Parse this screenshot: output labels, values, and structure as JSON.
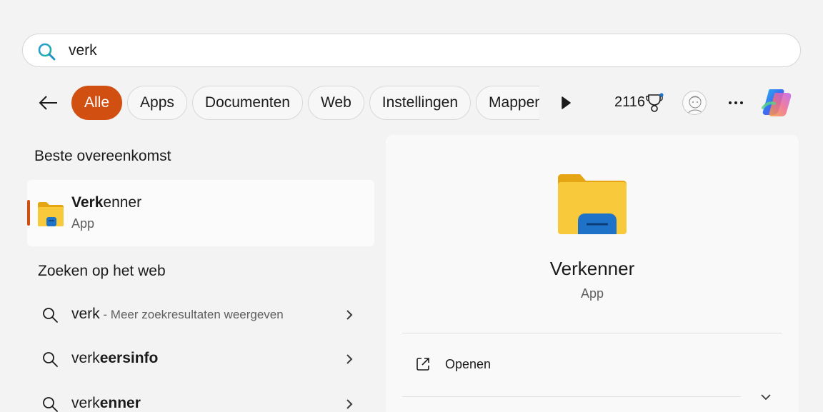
{
  "search": {
    "value": "verk",
    "placeholder": ""
  },
  "filters": {
    "chips": [
      {
        "label": "Alle",
        "active": true
      },
      {
        "label": "Apps",
        "active": false
      },
      {
        "label": "Documenten",
        "active": false
      },
      {
        "label": "Web",
        "active": false
      },
      {
        "label": "Instellingen",
        "active": false
      },
      {
        "label": "Mappen",
        "active": false
      }
    ]
  },
  "toolbar": {
    "points": "2116"
  },
  "best_match": {
    "heading": "Beste overeenkomst",
    "name_bold": "Verk",
    "name_rest": "enner",
    "type": "App"
  },
  "web": {
    "heading": "Zoeken op het web",
    "items": [
      {
        "plain": "verk",
        "bold": "",
        "suffix": " - Meer zoekresultaten weergeven"
      },
      {
        "plain": "verk",
        "bold": "eersinfo",
        "suffix": ""
      },
      {
        "plain": "verk",
        "bold": "enner",
        "suffix": ""
      }
    ]
  },
  "detail": {
    "name": "Verkenner",
    "type": "App",
    "actions": [
      {
        "label": "Openen"
      }
    ]
  },
  "colors": {
    "accent": "#d24f12",
    "folder_yellow": "#f8c93a",
    "folder_blue": "#1e73c8"
  }
}
